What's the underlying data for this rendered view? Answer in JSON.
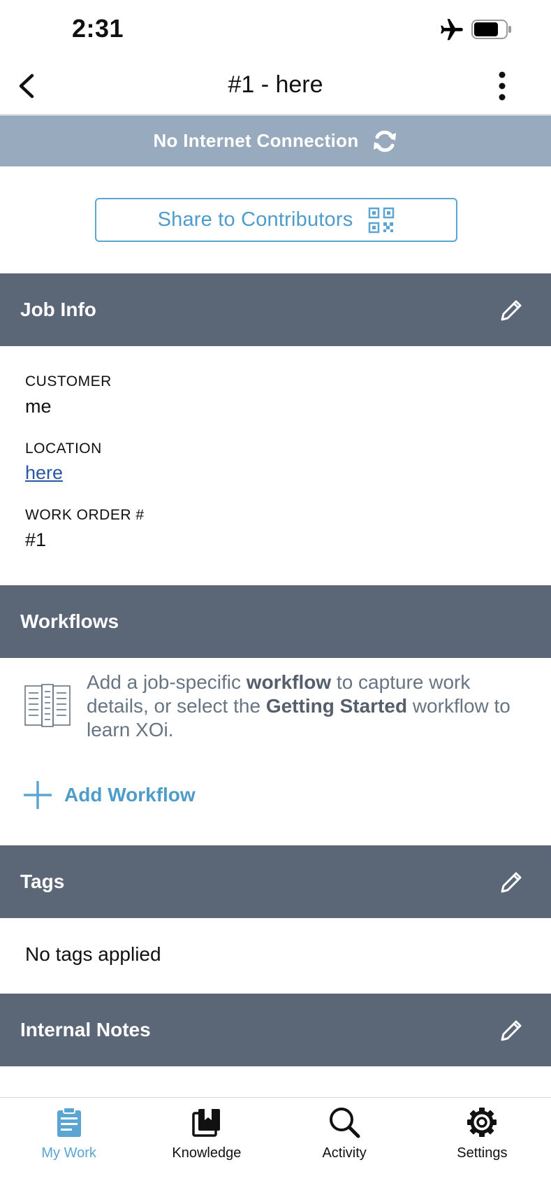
{
  "status_bar": {
    "time": "2:31"
  },
  "nav": {
    "title": "#1 - here"
  },
  "banner": {
    "text": "No Internet Connection"
  },
  "share": {
    "label": "Share to Contributors"
  },
  "job_info": {
    "title": "Job Info",
    "customer_label": "CUSTOMER",
    "customer_value": "me",
    "location_label": "LOCATION",
    "location_value": "here",
    "work_order_label": "WORK ORDER #",
    "work_order_value": "#1"
  },
  "workflows": {
    "title": "Workflows",
    "desc_part1": "Add a job-specific ",
    "desc_bold1": "workflow",
    "desc_part2": " to capture work details, or select the ",
    "desc_bold2": "Getting Started",
    "desc_part3": " workflow to learn XOi.",
    "add_label": "Add Workflow"
  },
  "tags": {
    "title": "Tags",
    "empty_text": "No tags applied"
  },
  "internal_notes": {
    "title": "Internal Notes"
  },
  "tabs": [
    {
      "label": "My Work",
      "icon": "clipboard-icon",
      "active": true
    },
    {
      "label": "Knowledge",
      "icon": "library-icon",
      "active": false
    },
    {
      "label": "Activity",
      "icon": "search-icon",
      "active": false
    },
    {
      "label": "Settings",
      "icon": "gear-icon",
      "active": false
    }
  ],
  "colors": {
    "section_header": "#5b6677",
    "banner": "#98aabd",
    "accent": "#5ba5d3",
    "link": "#2a56a6"
  }
}
